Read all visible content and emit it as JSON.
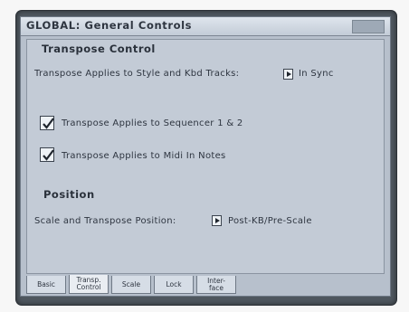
{
  "title": "GLOBAL: General Controls",
  "transpose_section": {
    "heading": "Transpose Control",
    "applies_label": "Transpose Applies to Style and Kbd Tracks:",
    "applies_value": "In Sync",
    "check_sequencer": "Transpose Applies to Sequencer 1 & 2",
    "check_midi": "Transpose Applies to Midi In Notes"
  },
  "position_section": {
    "heading": "Position",
    "label": "Scale and Transpose Position:",
    "value": "Post-KB/Pre-Scale"
  },
  "tabs": [
    {
      "line1": "Basic",
      "line2": ""
    },
    {
      "line1": "Transp.",
      "line2": "Control"
    },
    {
      "line1": "Scale",
      "line2": ""
    },
    {
      "line1": "Lock",
      "line2": ""
    },
    {
      "line1": "Inter-",
      "line2": "face"
    }
  ]
}
